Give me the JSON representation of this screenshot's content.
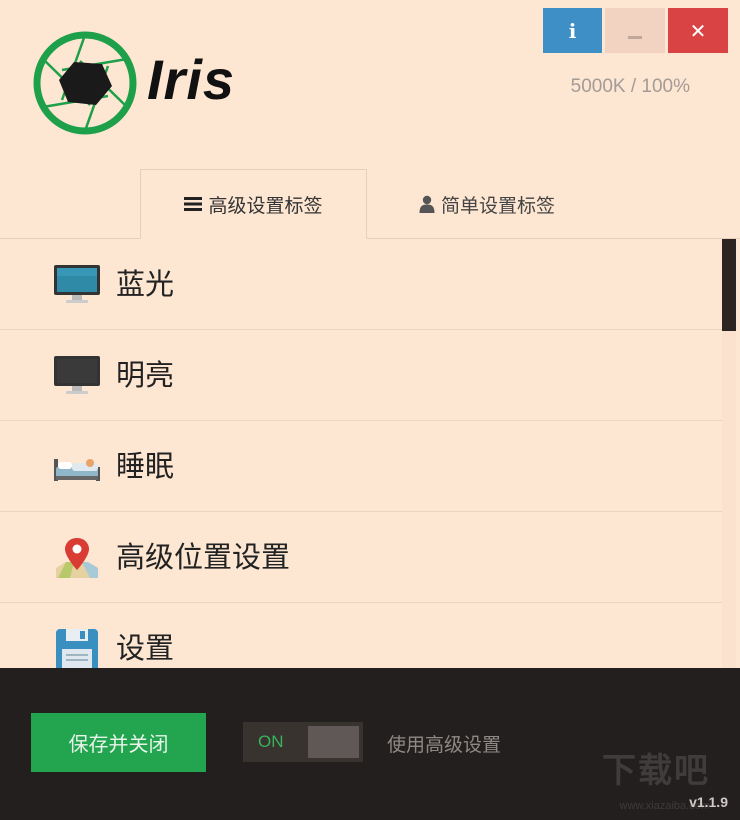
{
  "window": {
    "info_label": "i",
    "minimize_label": "",
    "close_label": "✕"
  },
  "header": {
    "app_name": "Iris",
    "status": "5000K / 100%"
  },
  "tabs": [
    {
      "label": "高级设置标签",
      "icon": "menu-icon",
      "active": true
    },
    {
      "label": "简单设置标签",
      "icon": "user-icon",
      "active": false
    }
  ],
  "list": {
    "items": [
      {
        "label": "蓝光",
        "icon": "monitor-blue-icon"
      },
      {
        "label": "明亮",
        "icon": "monitor-dark-icon"
      },
      {
        "label": "睡眠",
        "icon": "bed-icon"
      },
      {
        "label": "高级位置设置",
        "icon": "map-pin-icon"
      },
      {
        "label": "设置",
        "icon": "floppy-disk-icon"
      }
    ]
  },
  "footer": {
    "save_label": "保存并关闭",
    "toggle_label": "ON",
    "toggle_state": "on",
    "advanced_label": "使用高级设置",
    "version": "v1.1.9",
    "watermark": "下载吧",
    "watermark_sub": "www.xiazaiba.com"
  },
  "colors": {
    "background": "#fde6d2",
    "footer_bg": "#231f1e",
    "accent_green": "#22a54e",
    "info_blue": "#3d8fc5",
    "close_red": "#d94343"
  }
}
